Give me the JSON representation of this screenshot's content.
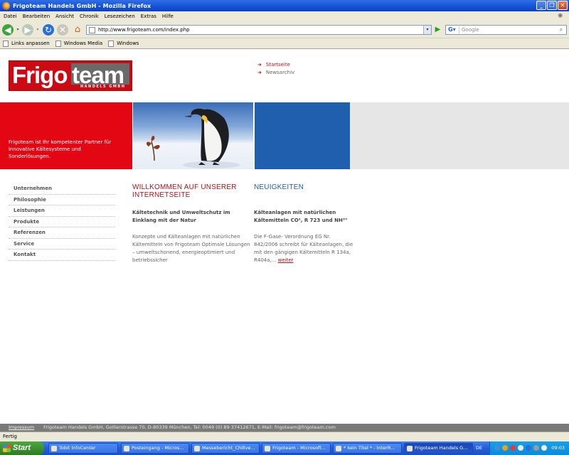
{
  "window": {
    "title": "Frigoteam Handels GmbH - Mozilla Firefox",
    "buttons": [
      "_",
      "❐",
      "✕"
    ]
  },
  "menu": [
    "Datei",
    "Bearbeiten",
    "Ansicht",
    "Chronik",
    "Lesezeichen",
    "Extras",
    "Hilfe"
  ],
  "toolbar": {
    "url": "http://www.frigoteam.com/index.php",
    "search_placeholder": "Google",
    "icons": [
      "back-icon",
      "forward-icon",
      "reload-icon",
      "stop-icon",
      "home-icon",
      "go-icon",
      "search-icon"
    ]
  },
  "bookmarks": [
    "Links anpassen",
    "Windows Media",
    "Windows"
  ],
  "site": {
    "logo": {
      "frigo": "Frigo",
      "team": "team",
      "sub": "HANDELS GMBH"
    },
    "topnav": [
      {
        "label": "Startseite",
        "active": true
      },
      {
        "label": "Newsarchiv",
        "active": false
      }
    ],
    "band_text": "Frigoteam ist Ihr kompetenter Partner für innovative Kältesysteme und Sonderlösungen.",
    "leftnav": [
      "Unternehmen",
      "Philosophie",
      "Leistungen",
      "Produkte",
      "Referenzen",
      "Service",
      "Kontakt"
    ],
    "welcome": {
      "title": "WILLKOMMEN AUF UNSERER INTERNETSEITE",
      "subtitle": "Kältetechnik und Umweltschutz im Einklang mit der Natur",
      "body": "Konzepte und Kälteanlagen mit natürlichen Kältemitteln von Frigoteam Optimale Lösungen – umweltschonend, energieoptimiert und betriebssicher"
    },
    "news": {
      "title": "NEUIGKEITEN",
      "subtitle": "Kälteanlagen mit natürlichen Kältemitteln CO², R 723 und NH³\"",
      "body": "Die F-Gase- Verordnung EG Nr. 842/2006 schreibt für Kälteanlagen, die mit den gängigen Kältemitteln R 134a, R404a,...",
      "link": "weiter"
    },
    "footer": {
      "impressum": "Impressum",
      "address": "Frigoteam Handels GmbH, Gollierstrasse 70, D-80339 München, Tel: 0049 (0) 89 37412671, E-Mail: frigoteam@frigoteam.com"
    },
    "colors": {
      "red": "#e30613",
      "blue": "#1f5fae",
      "grey": "#e6e6e6"
    }
  },
  "status": "Fertig",
  "taskbar": {
    "start": "Start",
    "items": [
      {
        "label": "Tobit InfoCenter",
        "active": false
      },
      {
        "label": "Posteingang - Micros...",
        "active": false
      },
      {
        "label": "Messebericht_Chillve...",
        "active": false
      },
      {
        "label": "Frigoteam - Microsoft...",
        "active": false
      },
      {
        "label": "* kein Titel * - InterR...",
        "active": false
      },
      {
        "label": "Frigoteam Handels G...",
        "active": true
      }
    ],
    "lang": "DE",
    "clock": "09:03"
  }
}
